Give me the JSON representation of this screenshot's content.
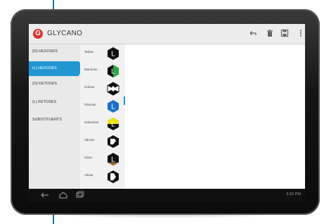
{
  "app": {
    "title": "GLYCANO",
    "logo_letter": "G"
  },
  "actionbar": {
    "icons": [
      "undo-icon",
      "trash-icon",
      "save-icon",
      "overflow-menu-icon"
    ]
  },
  "sidebar": {
    "items": [
      {
        "label": "(D) HEXOSES",
        "active": false
      },
      {
        "label": "(L) HEXOSES",
        "active": true
      },
      {
        "label": "(D) KETOSES",
        "active": false
      },
      {
        "label": "(L) KETOSES",
        "active": false
      },
      {
        "label": "SUBSTITUENTS",
        "active": false
      }
    ]
  },
  "list": {
    "items": [
      {
        "label": "Talose",
        "letter": "L",
        "shape": "hexagon-black",
        "color": "#111111"
      },
      {
        "label": "Mannose",
        "letter": "L",
        "shape": "hexagon-green-half",
        "color": "#2aa84a"
      },
      {
        "label": "Gulose",
        "letter": "L",
        "shape": "hexagon-quartered",
        "color": "#111111"
      },
      {
        "label": "Glucose",
        "letter": "L",
        "shape": "hexagon-blue",
        "color": "#1f6fc9"
      },
      {
        "label": "Galactose",
        "letter": "L",
        "shape": "hexagon-yellow-half",
        "color": "#f2e20c"
      },
      {
        "label": "Altrose",
        "letter": "L",
        "shape": "hexagon-split",
        "color": "#111111"
      },
      {
        "label": "Idose",
        "letter": "L",
        "shape": "hexagon-brown-half",
        "color": "#a0632c"
      },
      {
        "label": "Allose",
        "letter": "L",
        "shape": "hexagon-split",
        "color": "#111111"
      }
    ]
  },
  "navbar": {
    "icons": [
      "back-icon",
      "home-icon",
      "recent-apps-icon"
    ],
    "status_text": "5:02 PM"
  }
}
